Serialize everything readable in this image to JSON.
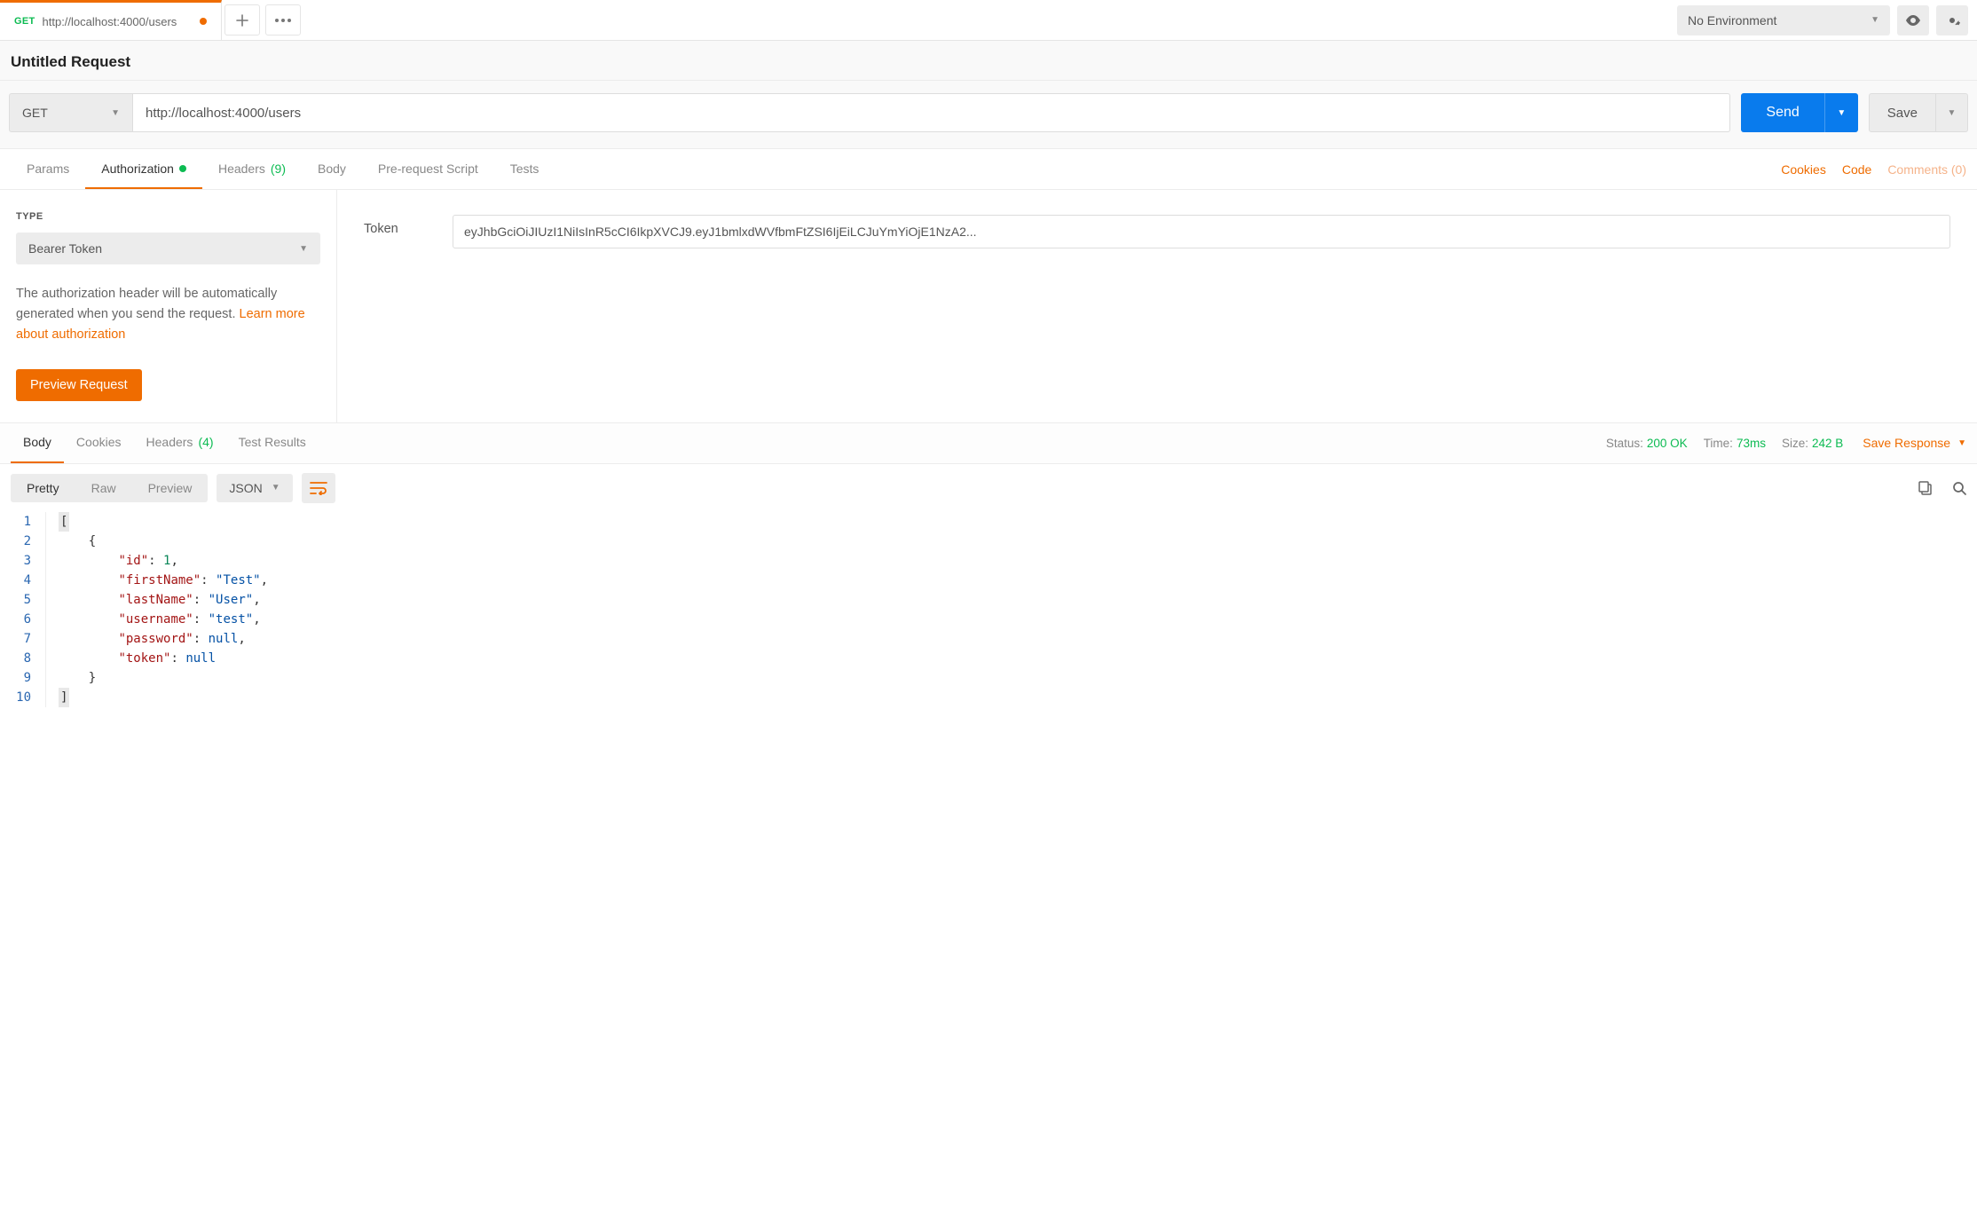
{
  "tab": {
    "method": "GET",
    "title": "http://localhost:4000/users"
  },
  "environment": {
    "selected": "No Environment"
  },
  "request": {
    "name": "Untitled Request",
    "method": "GET",
    "url": "http://localhost:4000/users",
    "send_label": "Send",
    "save_label": "Save"
  },
  "req_tabs": {
    "params": "Params",
    "authorization": "Authorization",
    "headers": "Headers",
    "headers_count": "(9)",
    "body": "Body",
    "prerequest": "Pre-request Script",
    "tests": "Tests",
    "cookies_link": "Cookies",
    "code_link": "Code",
    "comments_link": "Comments (0)"
  },
  "auth": {
    "type_label": "TYPE",
    "type_value": "Bearer Token",
    "description_a": "The authorization header will be automatically generated when you send the request. ",
    "description_link": "Learn more about authorization",
    "preview_label": "Preview Request",
    "token_label": "Token",
    "token_value": "eyJhbGciOiJIUzI1NiIsInR5cCI6IkpXVCJ9.eyJ1bmlxdWVfbmFtZSI6IjEiLCJuYmYiOjE1NzA2..."
  },
  "resp_tabs": {
    "body": "Body",
    "cookies": "Cookies",
    "headers": "Headers",
    "headers_count": "(4)",
    "test_results": "Test Results"
  },
  "resp_meta": {
    "status_label": "Status:",
    "status_value": "200 OK",
    "time_label": "Time:",
    "time_value": "73ms",
    "size_label": "Size:",
    "size_value": "242 B",
    "save_response": "Save Response"
  },
  "resp_toolbar": {
    "pretty": "Pretty",
    "raw": "Raw",
    "preview": "Preview",
    "format": "JSON"
  },
  "response_body": {
    "lines": [
      "1",
      "2",
      "3",
      "4",
      "5",
      "6",
      "7",
      "8",
      "9",
      "10"
    ],
    "data": [
      {
        "id": 1,
        "firstName": "Test",
        "lastName": "User",
        "username": "test",
        "password": null,
        "token": null
      }
    ]
  }
}
